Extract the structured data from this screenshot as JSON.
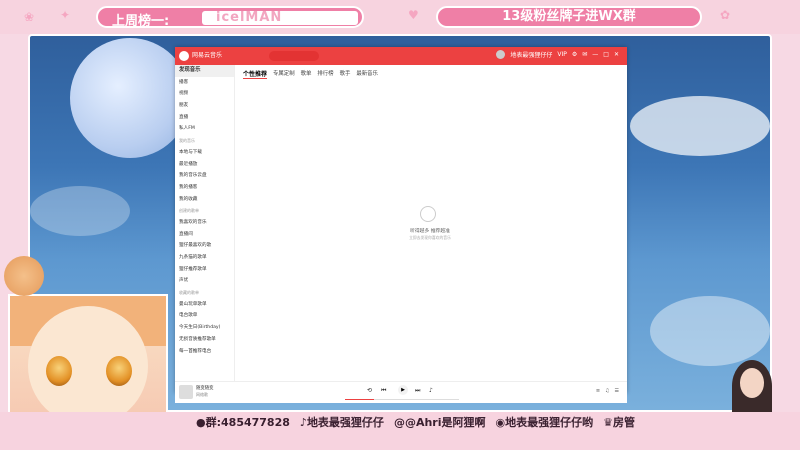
{
  "overlay": {
    "rank_label": "上周榜一:",
    "rank_name": "icelMAN",
    "group_label": "13级粉丝牌子进WX群"
  },
  "app": {
    "name": "网易云音乐",
    "user": "地表最强狸仔仔",
    "vip": "VIP",
    "sidebar": [
      {
        "label": "发现音乐",
        "active": true
      },
      {
        "label": "播客"
      },
      {
        "label": "视频"
      },
      {
        "label": "朋友"
      },
      {
        "label": "直播"
      },
      {
        "label": "私人FM"
      },
      {
        "label": "我的音乐",
        "head": true
      },
      {
        "label": "本地与下载"
      },
      {
        "label": "最近播放"
      },
      {
        "label": "我的音乐云盘"
      },
      {
        "label": "我的播客"
      },
      {
        "label": "我的收藏"
      },
      {
        "label": "创建的歌单",
        "head": true
      },
      {
        "label": "我喜欢的音乐"
      },
      {
        "label": "直播间"
      },
      {
        "label": "狸仔最喜欢的歌"
      },
      {
        "label": "九条猫的歌单"
      },
      {
        "label": "狸仔推荐歌单"
      },
      {
        "label": "声优"
      },
      {
        "label": "收藏的歌单",
        "head": true
      },
      {
        "label": "曼山玩单歌单"
      },
      {
        "label": "电台歌单"
      },
      {
        "label": "今天生日(Birthday)"
      },
      {
        "label": "无损音质推荐歌单"
      },
      {
        "label": "每一首推荐电台"
      }
    ],
    "tabs": [
      {
        "label": "个性推荐",
        "active": true
      },
      {
        "label": "专属定制"
      },
      {
        "label": "歌单"
      },
      {
        "label": "排行榜"
      },
      {
        "label": "歌手"
      },
      {
        "label": "最新音乐"
      }
    ],
    "empty_title": "听得越多 推荐越准",
    "empty_sub": "立即去发现你喜欢的音乐",
    "player": {
      "song": "随变随变",
      "artist": "网络歌",
      "progress": 0.25
    }
  },
  "bottom": {
    "items": [
      {
        "icon": "penguin-icon",
        "text": "群:485477828"
      },
      {
        "icon": "tiktok-icon",
        "text": "地表最强狸仔仔"
      },
      {
        "icon": "at-icon",
        "text": "@Ahri是阿狸啊"
      },
      {
        "icon": "weibo-icon",
        "text": "地表最强狸仔仔哟"
      },
      {
        "icon": "crown-icon",
        "text": "房管"
      }
    ]
  },
  "colors": {
    "accent": "#ec4141",
    "pink": "#ef7fa6"
  }
}
